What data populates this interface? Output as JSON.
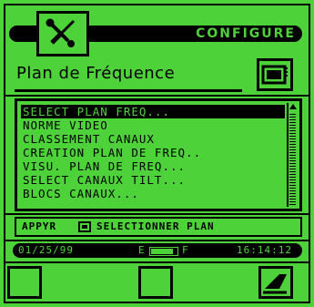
{
  "colors": {
    "background": "#4ed23a",
    "foreground": "#000000"
  },
  "header": {
    "title": "CONFIGURE",
    "tool_icon": "tools-icon"
  },
  "subtitle": {
    "text": "Plan de Fréquence",
    "tv_icon": "tv-icon"
  },
  "menu": {
    "items": [
      {
        "label": "SELECT PLAN FREQ...",
        "selected": true
      },
      {
        "label": "NORME VIDEO",
        "selected": false
      },
      {
        "label": "CLASSEMENT CANAUX",
        "selected": false
      },
      {
        "label": "CREATION PLAN DE FREQ..",
        "selected": false
      },
      {
        "label": "VISU. PLAN DE FREQ...",
        "selected": false
      },
      {
        "label": "SELECT CANAUX TILT...",
        "selected": false
      },
      {
        "label": "BLOCS CANAUX...",
        "selected": false
      }
    ]
  },
  "hint": {
    "left": "APPYR",
    "key_icon": "enter-key-icon",
    "right": "SELECTIONNER PLAN"
  },
  "status": {
    "date": "01/25/99",
    "battery_left": "E",
    "battery_right": "F",
    "time": "16:14:12"
  },
  "buttons": {
    "left": "",
    "middle": "",
    "right_icon": "erase-icon"
  }
}
